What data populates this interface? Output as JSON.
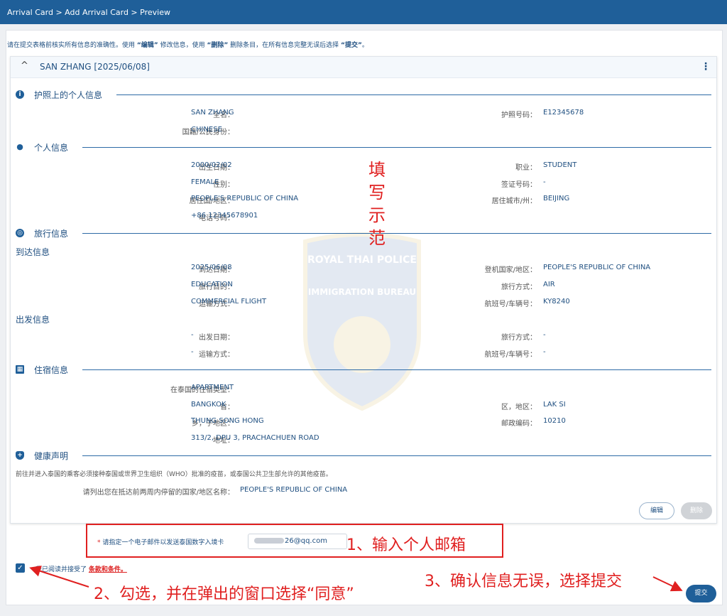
{
  "breadcrumb": "Arrival Card > Add Arrival Card > Preview",
  "intro": {
    "p1": "请在提交表格前核实所有信息的准确性。使用 ",
    "edit": "“编辑”",
    "p2": " 修改信息，使用 ",
    "del": "“删除”",
    "p3": " 删除条目，在所有信息完整无误后选择 ",
    "submit": "“提交”",
    "p4": "。"
  },
  "card": {
    "title": "SAN ZHANG [2025/06/08]",
    "chevron": "^",
    "kebab": "⋮"
  },
  "sections": {
    "passport": {
      "title": "护照上的个人信息",
      "fields": {
        "name_l": "全名：",
        "name_v": "SAN ZHANG",
        "passno_l": "护照号码：",
        "passno_v": "E12345678",
        "nat_l": "国籍/公民身份：",
        "nat_v": "CHINESE"
      }
    },
    "personal": {
      "title": "个人信息",
      "fields": {
        "dob_l": "出生日期：",
        "dob_v": "2000/02/02",
        "job_l": "职业：",
        "job_v": "STUDENT",
        "sex_l": "性别：",
        "sex_v": "FEMALE",
        "visa_l": "签证号码：",
        "visa_v": "-",
        "country_l": "居住国/地区：",
        "country_v": "PEOPLE'S REPUBLIC OF CHINA",
        "city_l": "居住城市/州：",
        "city_v": "BEIJING",
        "phone_l": "电话号码：",
        "phone_v": "+86 12345678901"
      }
    },
    "travel": {
      "title": "旅行信息",
      "arrival_title": "到达信息",
      "departure_title": "出发信息",
      "fields": {
        "arr_date_l": "到达日期：",
        "arr_date_v": "2025/06/08",
        "board_l": "登机国家/地区：",
        "board_v": "PEOPLE'S REPUBLIC OF CHINA",
        "purpose_l": "旅行目的：",
        "purpose_v": "EDUCATION",
        "mode_l": "旅行方式：",
        "mode_v": "AIR",
        "transport_l": "运输方式：",
        "transport_v": "COMMERCIAL FLIGHT",
        "flight_l": "航班号/车辆号：",
        "flight_v": "KY8240",
        "dep_date_l": "出发日期：",
        "dep_date_v": "-",
        "dep_mode_l": "旅行方式：",
        "dep_mode_v": "-",
        "dep_transport_l": "运输方式：",
        "dep_transport_v": "-",
        "dep_flight_l": "航班号/车辆号：",
        "dep_flight_v": "-"
      }
    },
    "stay": {
      "title": "住宿信息",
      "fields": {
        "type_l": "在泰国的住宿类型：",
        "type_v": "APARTMENT",
        "prov_l": "省：",
        "prov_v": "BANGKOK",
        "dist_l": "区，地区：",
        "dist_v": "LAK SI",
        "sub_l": "乡，子地区：",
        "sub_v": "THUNG SONG HONG",
        "zip_l": "邮政编码：",
        "zip_v": "10210",
        "addr_l": "地址：",
        "addr_v": "313/2, DPU 3, PRACHACHUEN ROAD"
      }
    },
    "health": {
      "title": "健康声明",
      "note": "前往并进入泰国的乘客必须接种泰国或世界卫生组织（WHO）批准的疫苗，或泰国公共卫生部允许的其他疫苗。",
      "visited_l": "请列出您在抵达前两周内停留的国家/地区名称：",
      "visited_v": "PEOPLE'S REPUBLIC OF CHINA"
    }
  },
  "buttons": {
    "edit": "编辑",
    "delete": "删除",
    "submit": "提交"
  },
  "email": {
    "star": "*",
    "label": "请指定一个电子邮件以发送泰国数字入境卡",
    "value_visible": "26@qq.com"
  },
  "terms": {
    "text": "我已阅读并接受了",
    "link": "条款和条件。",
    "checked": true
  },
  "annotations": {
    "sample": [
      "填",
      "写",
      "示",
      "范"
    ],
    "step1": "1、输入个人邮箱",
    "step2": "2、勾选，并在弹出的窗口选择“同意”",
    "step3": "3、确认信息无误，选择提交"
  },
  "watermark": {
    "line1": "ROYAL THAI POLICE",
    "line2": "IMMIGRATION BUREAU"
  },
  "colors": {
    "brand": "#1f5f99",
    "annotation": "#e02020"
  }
}
